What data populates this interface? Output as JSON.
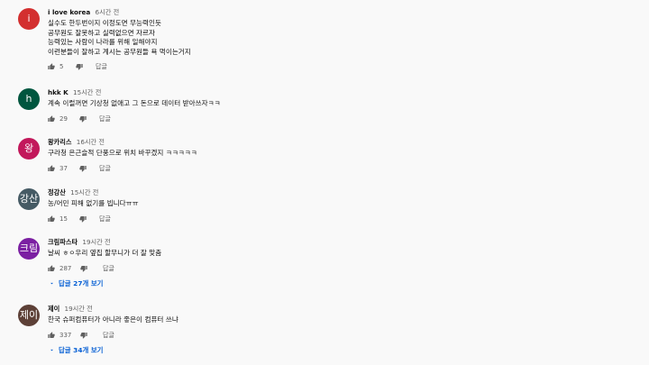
{
  "labels": {
    "reply": "답글"
  },
  "comments": [
    {
      "author": "i love korea",
      "time": "6시간 전",
      "avatar_text": "i",
      "avatar_color": "#d32f2f",
      "lines": [
        "실수도 한두번이지 이정도면 무능력인듯",
        "공무원도 잘못하고 실력없으면 자르자",
        "능력있는 사람이 나라를 위해 일해야지",
        "이런분들이 잘하고 계시는 공무원들 욕 먹이는거지"
      ],
      "likes": "5",
      "replies": ""
    },
    {
      "author": "hkk K",
      "time": "15시간 전",
      "avatar_text": "h",
      "avatar_color": "#00563f",
      "lines": [
        "계속 이럴꺼면 기상청 없애고 그 돈으로 데이터 받아쓰자ㅋㅋ"
      ],
      "likes": "29",
      "replies": ""
    },
    {
      "author": "왕카리스",
      "time": "16시간 전",
      "avatar_text": "왕",
      "avatar_color": "#c2185b",
      "lines": [
        "구라청 은근슬적 단풍으로 위치 바꾸겠지 ㅋㅋㅋㅋㅋ"
      ],
      "likes": "37",
      "replies": ""
    },
    {
      "author": "정강산",
      "time": "15시간 전",
      "avatar_text": "강산",
      "avatar_color": "#455a64",
      "lines": [
        "농/어민 피해 없기를 빕니다ㅠㅠ"
      ],
      "likes": "15",
      "replies": ""
    },
    {
      "author": "크림파스타",
      "time": "19시간 전",
      "avatar_text": "크림",
      "avatar_color": "#7b1fa2",
      "lines": [
        "날씨 ㅎㅇ우리 옆집 할무니가 더 잘 맞춤"
      ],
      "likes": "287",
      "replies": "답글 27개 보기"
    },
    {
      "author": "제이",
      "time": "19시간 전",
      "avatar_text": "제이",
      "avatar_color": "#5d4037",
      "lines": [
        "한국 슈퍼컴퓨터가 아니라 좋은이 컴퓨터 쓰냐"
      ],
      "likes": "337",
      "replies": "답글 34개 보기"
    }
  ]
}
